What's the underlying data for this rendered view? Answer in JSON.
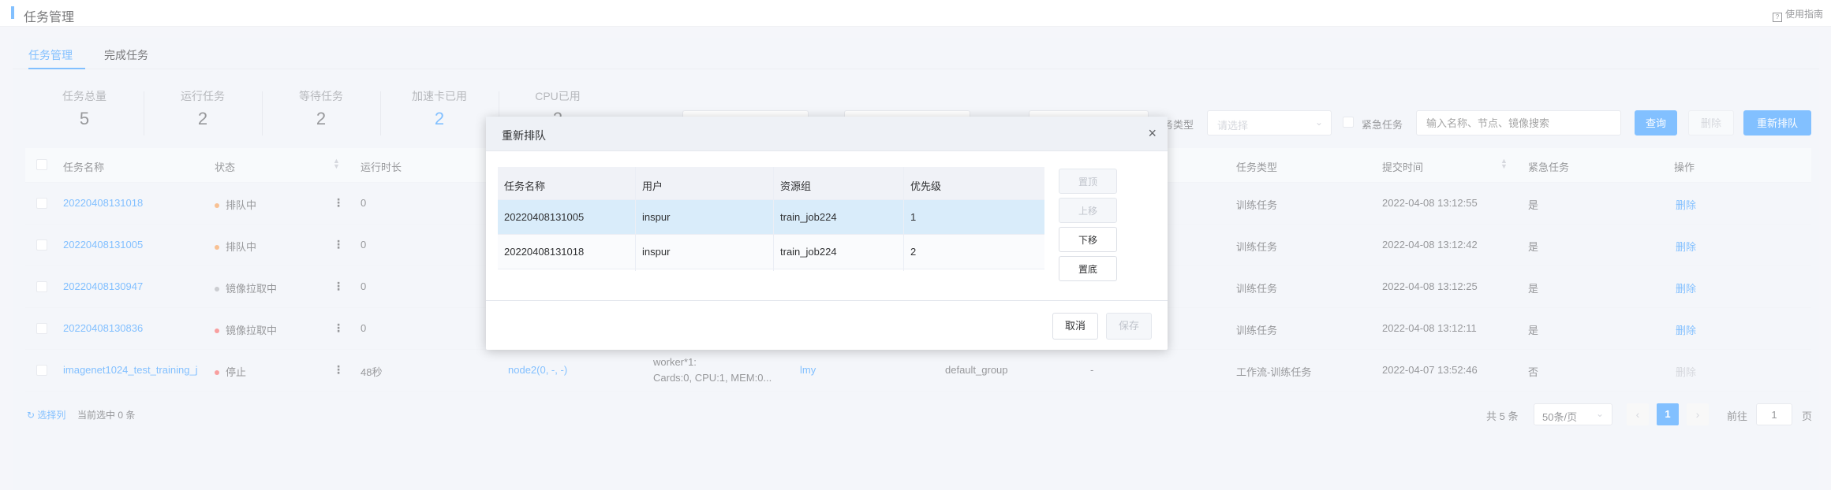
{
  "header": {
    "title": "任务管理",
    "guide": "使用指南"
  },
  "tabs": [
    {
      "label": "任务管理"
    },
    {
      "label": "完成任务"
    }
  ],
  "stats": [
    {
      "label": "任务总量",
      "value": "5"
    },
    {
      "label": "运行任务",
      "value": "2"
    },
    {
      "label": "等待任务",
      "value": "2"
    },
    {
      "label": "加速卡已用",
      "value": "2"
    },
    {
      "label": "CPU已用",
      "value": "2"
    }
  ],
  "filters": {
    "type_label": "务类型",
    "type_placeholder": "请选择",
    "urgent_label": "紧急任务",
    "search_placeholder": "输入名称、节点、镜像搜索"
  },
  "toolbar": {
    "query": "查询",
    "delete": "删除",
    "requeue": "重新排队"
  },
  "table": {
    "headers": [
      "任务名称",
      "状态",
      "运行时长",
      "任务类型",
      "提交时间",
      "紧急任务",
      "操作"
    ],
    "rows": [
      {
        "name": "20220408131018",
        "status": "排队中",
        "status_color": "#f5a05a",
        "duration": "0",
        "node": "",
        "resources": "",
        "user": "",
        "group": "",
        "extra": "",
        "type": "训练任务",
        "time": "2022-04-08 13:12:55",
        "urgent": "是",
        "action": "删除"
      },
      {
        "name": "20220408131005",
        "status": "排队中",
        "status_color": "#f5a05a",
        "duration": "0",
        "node": "",
        "resources": "",
        "user": "",
        "group": "",
        "extra": "",
        "type": "训练任务",
        "time": "2022-04-08 13:12:42",
        "urgent": "是",
        "action": "删除"
      },
      {
        "name": "20220408130947",
        "status": "镜像拉取中",
        "status_color": "#b0b3b8",
        "duration": "0",
        "node": "",
        "resources": "",
        "user": "",
        "group": "",
        "extra": "",
        "type": "训练任务",
        "time": "2022-04-08 13:12:25",
        "urgent": "是",
        "action": "删除"
      },
      {
        "name": "20220408130836",
        "status": "镜像拉取中",
        "status_color": "#f56c6c",
        "duration": "0",
        "node": "",
        "resources": "",
        "user": "",
        "group": "",
        "extra": "",
        "type": "训练任务",
        "time": "2022-04-08 13:12:11",
        "urgent": "是",
        "action": "删除"
      },
      {
        "name": "imagenet1024_test_training_j",
        "status": "停止",
        "status_color": "#f56c6c",
        "duration": "48秒",
        "node": "node2(0, -, -)",
        "resources": "worker*1:",
        "resources2": "Cards:0, CPU:1, MEM:0...",
        "user": "lmy",
        "group": "default_group",
        "extra": "-",
        "type": "工作流-训练任务",
        "time": "2022-04-07 13:52:46",
        "urgent": "否",
        "action": "删除"
      }
    ]
  },
  "footer": {
    "select_col": "选择列",
    "selected": "当前选中 0 条",
    "total": "共 5 条",
    "page_size": "50条/页",
    "page": "1",
    "goto_label": "前往",
    "goto_value": "1",
    "goto_unit": "页"
  },
  "dialog": {
    "title": "重新排队",
    "headers": [
      "任务名称",
      "用户",
      "资源组",
      "优先级"
    ],
    "rows": [
      {
        "name": "20220408131005",
        "user": "inspur",
        "group": "train_job224",
        "priority": "1"
      },
      {
        "name": "20220408131018",
        "user": "inspur",
        "group": "train_job224",
        "priority": "2"
      }
    ],
    "side_buttons": {
      "top": "置顶",
      "up": "上移",
      "down": "下移",
      "bottom": "置底"
    },
    "cancel": "取消",
    "save": "保存"
  }
}
